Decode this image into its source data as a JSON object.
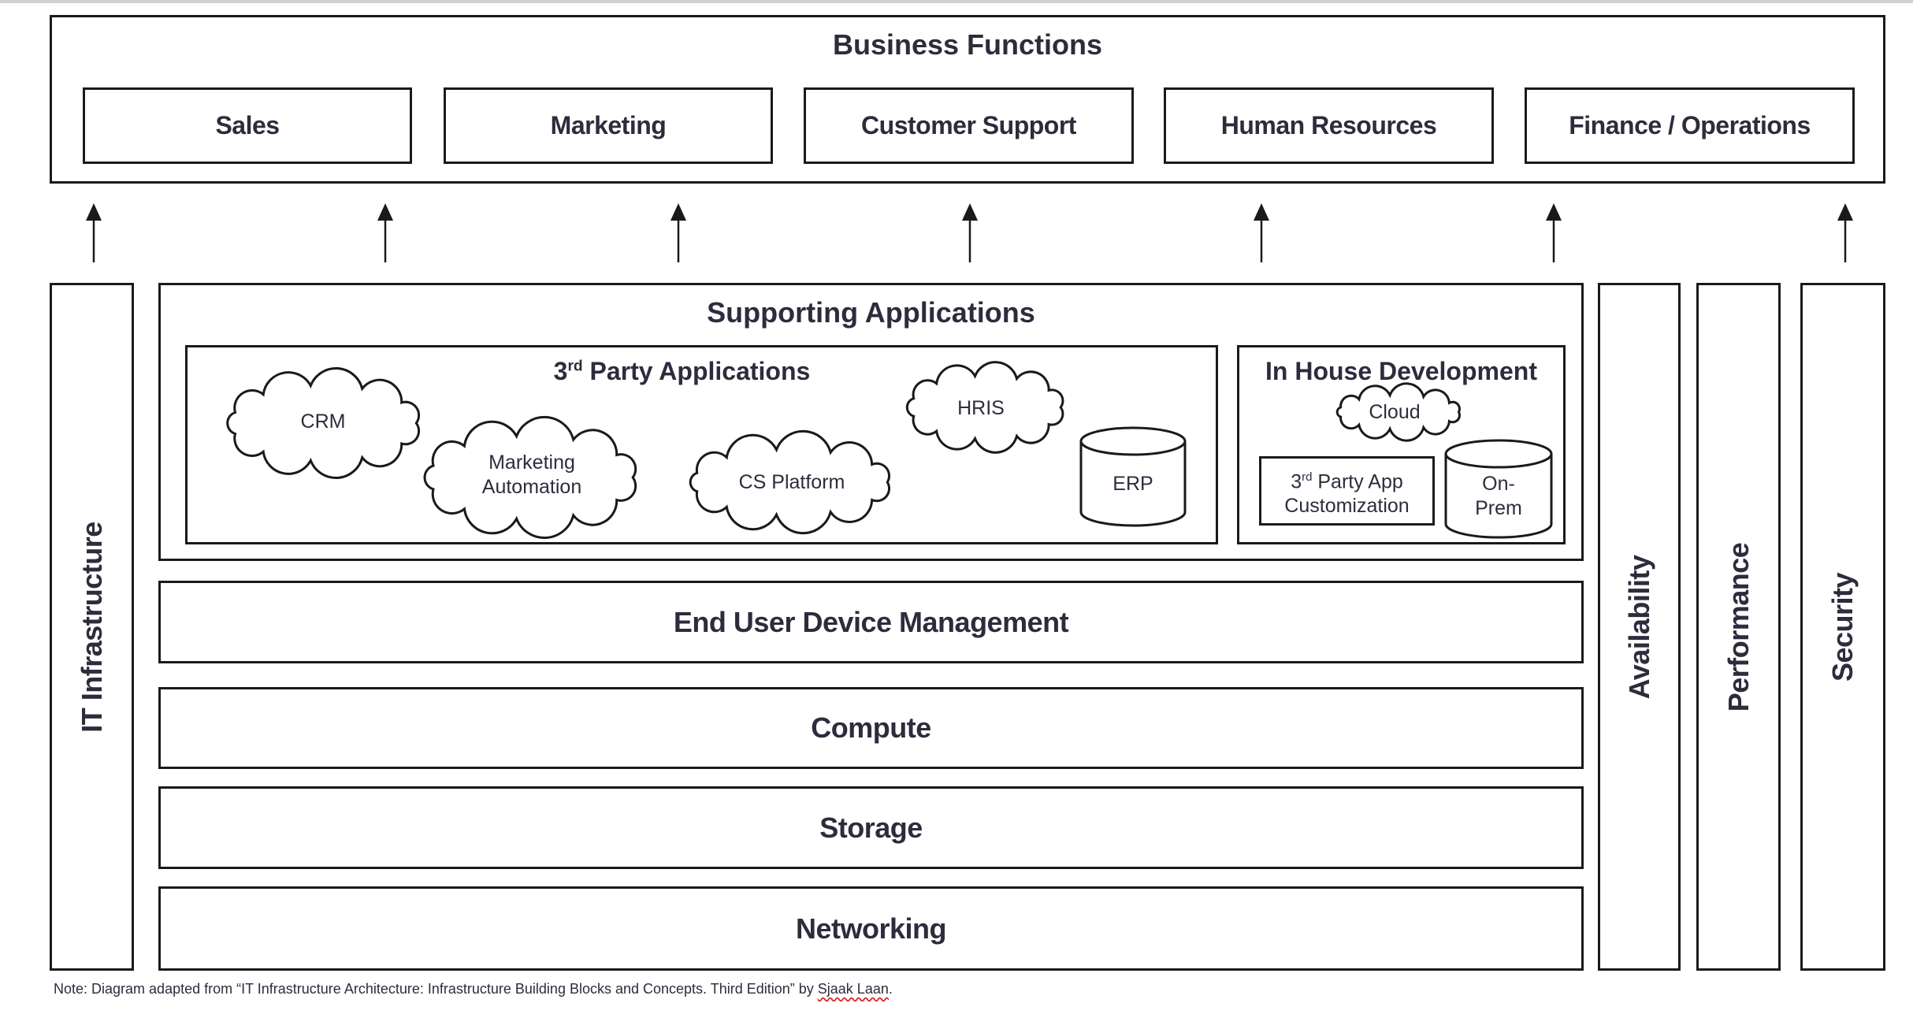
{
  "business_functions": {
    "title": "Business Functions",
    "items": [
      {
        "label": "Sales"
      },
      {
        "label": "Marketing"
      },
      {
        "label": "Customer Support"
      },
      {
        "label": "Human Resources"
      },
      {
        "label": "Finance / Operations"
      }
    ]
  },
  "arrows": {
    "count": 7,
    "direction": "up"
  },
  "it_infrastructure": {
    "label": "IT Infrastructure"
  },
  "supporting_applications": {
    "title": "Supporting Applications",
    "third_party": {
      "title_prefix": "3",
      "title_sup": "rd",
      "title_suffix": " Party Applications",
      "clouds": [
        {
          "label": "CRM"
        },
        {
          "label_line1": "Marketing",
          "label_line2": "Automation"
        },
        {
          "label": "CS Platform"
        },
        {
          "label": "HRIS"
        }
      ],
      "databases": [
        {
          "label": "ERP"
        }
      ]
    },
    "in_house": {
      "title": "In House Development",
      "cloud": {
        "label": "Cloud"
      },
      "customization": {
        "prefix": "3",
        "sup": "rd",
        "line1_suffix": " Party App",
        "line2": "Customization"
      },
      "database": {
        "line1": "On-",
        "line2": "Prem"
      }
    }
  },
  "layers": [
    {
      "label": "End User Device Management"
    },
    {
      "label": "Compute"
    },
    {
      "label": "Storage"
    },
    {
      "label": "Networking"
    }
  ],
  "cross_cutting": [
    {
      "label": "Availability"
    },
    {
      "label": "Performance"
    },
    {
      "label": "Security"
    }
  ],
  "note": {
    "text": "Note: Diagram adapted from “IT Infrastructure Architecture: Infrastructure Building Blocks and Concepts. Third Edition” by ",
    "author": "Sjaak Laan",
    "end": "."
  },
  "colors": {
    "line": "#1a1a1a",
    "text": "#2f2b3d",
    "spellcheck": "#dd2222"
  }
}
